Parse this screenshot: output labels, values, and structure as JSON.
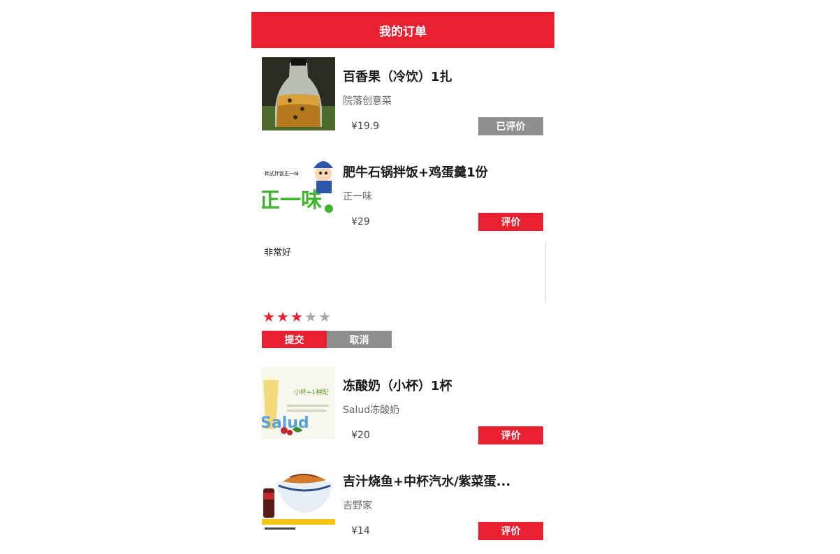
{
  "header": {
    "title": "我的订单"
  },
  "orders": [
    {
      "title": "百香果（冷饮）1扎",
      "shop": "院落创意菜",
      "price": "¥19.9",
      "action": "已评价",
      "rated": true
    },
    {
      "title": "肥牛石锅拌饭+鸡蛋羹1份",
      "shop": "正一味",
      "price": "¥29",
      "action": "评价",
      "rated": false,
      "thumb_text": [
        "韩式拌饭正一味",
        "正一味"
      ]
    },
    {
      "title": "冻酸奶（小杯）1杯",
      "shop": "Salud冻酸奶",
      "price": "¥20",
      "action": "评价",
      "rated": false,
      "thumb_text": [
        "小杯+1种配",
        "Salud"
      ]
    },
    {
      "title": "吉汁烧鱼+中杯汽水/紫菜蛋...",
      "shop": "吉野家",
      "price": "¥14",
      "action": "评价",
      "rated": false
    }
  ],
  "review": {
    "text": "非常好",
    "rating": 3,
    "max_rating": 5,
    "submit_label": "提交",
    "cancel_label": "取消"
  },
  "colors": {
    "accent": "#e8202f",
    "disabled": "#8f8f8f"
  }
}
